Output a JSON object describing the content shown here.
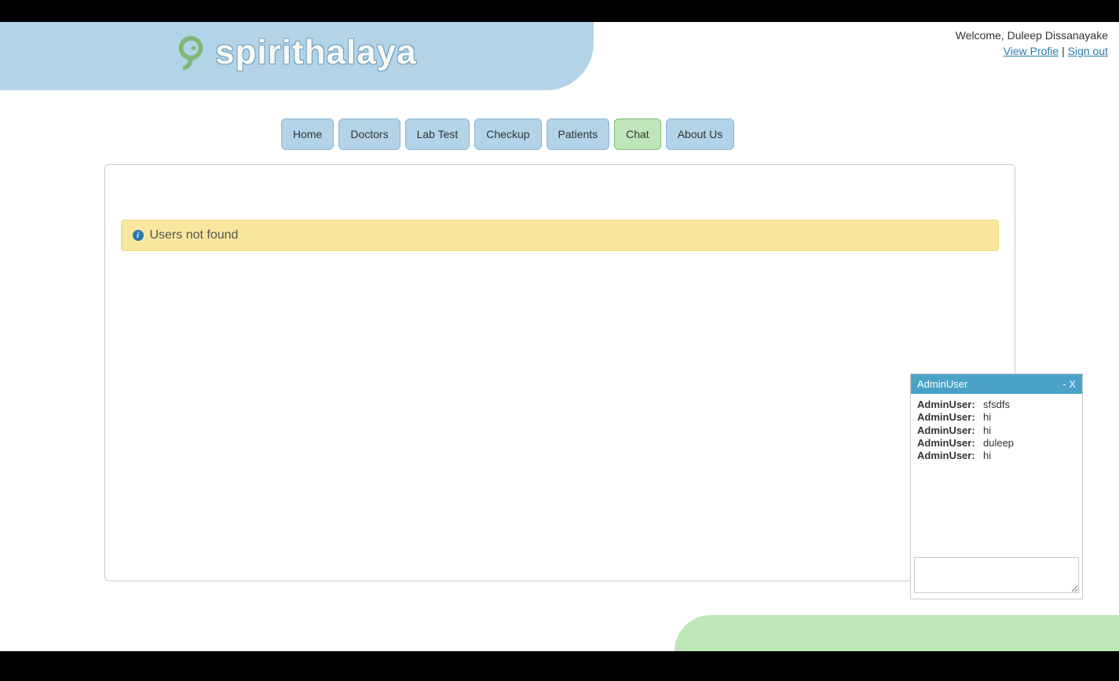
{
  "brand": {
    "name": "spirithalaya"
  },
  "user": {
    "welcome_prefix": "Welcome, ",
    "name": "Duleep Dissanayake",
    "view_profile": "View Profie",
    "separator": " | ",
    "sign_out": "Sign out"
  },
  "nav": {
    "items": [
      {
        "label": "Home",
        "active": false
      },
      {
        "label": "Doctors",
        "active": false
      },
      {
        "label": "Lab Test",
        "active": false
      },
      {
        "label": "Checkup",
        "active": false
      },
      {
        "label": "Patients",
        "active": false
      },
      {
        "label": "Chat",
        "active": true
      },
      {
        "label": "About Us",
        "active": false
      }
    ]
  },
  "alert": {
    "message": "Users not found"
  },
  "chat": {
    "title": "AdminUser",
    "minimize": "-",
    "close": "X",
    "messages": [
      {
        "from": "AdminUser:",
        "text": "sfsdfs"
      },
      {
        "from": "AdminUser:",
        "text": "hi"
      },
      {
        "from": "AdminUser:",
        "text": "hi"
      },
      {
        "from": "AdminUser:",
        "text": "duleep"
      },
      {
        "from": "AdminUser:",
        "text": "hi"
      }
    ],
    "input_value": ""
  }
}
